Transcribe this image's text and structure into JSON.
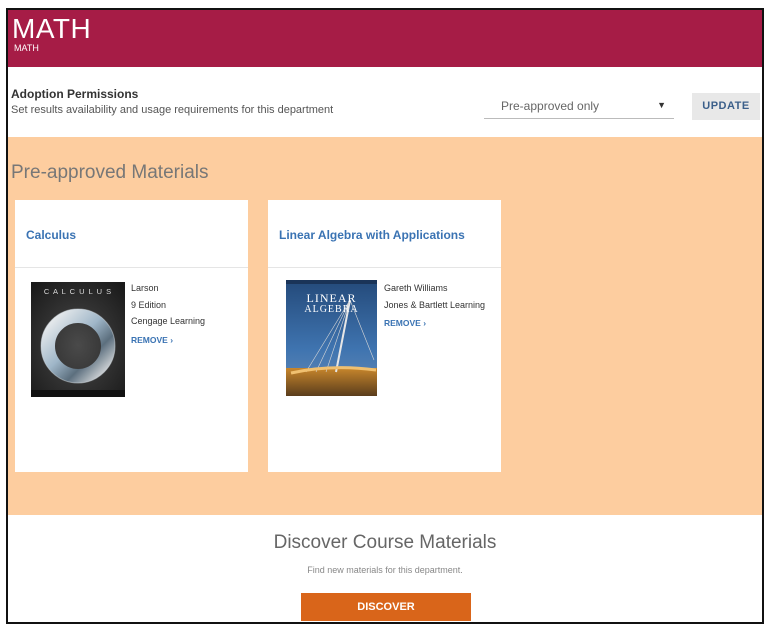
{
  "header": {
    "title": "MATH",
    "subtitle": "MATH"
  },
  "permissions": {
    "title": "Adoption Permissions",
    "description": "Set results availability and usage requirements for this department",
    "select_value": "Pre-approved only",
    "update_label": "UPDATE"
  },
  "preapproved": {
    "section_title": "Pre-approved Materials",
    "cards": [
      {
        "title": "Calculus",
        "author": "Larson",
        "edition": "9 Edition",
        "publisher": "Cengage Learning",
        "action_label": "REMOVE ›",
        "cover_text": "C A L C U L U S"
      },
      {
        "title": "Linear Algebra with Applications",
        "author": "Gareth Williams",
        "publisher": "Jones & Bartlett Learning",
        "action_label": "REMOVE ›",
        "cover_text_1": "LINEAR",
        "cover_text_2": "ALGEBRA"
      }
    ]
  },
  "discover": {
    "title": "Discover Course Materials",
    "subtitle": "Find new materials for this department.",
    "button_label": "DISCOVER"
  },
  "colors": {
    "header": "#a61c46",
    "section_bg": "#fdcd9f",
    "link": "#3a73b3",
    "discover_button": "#d9651a"
  }
}
